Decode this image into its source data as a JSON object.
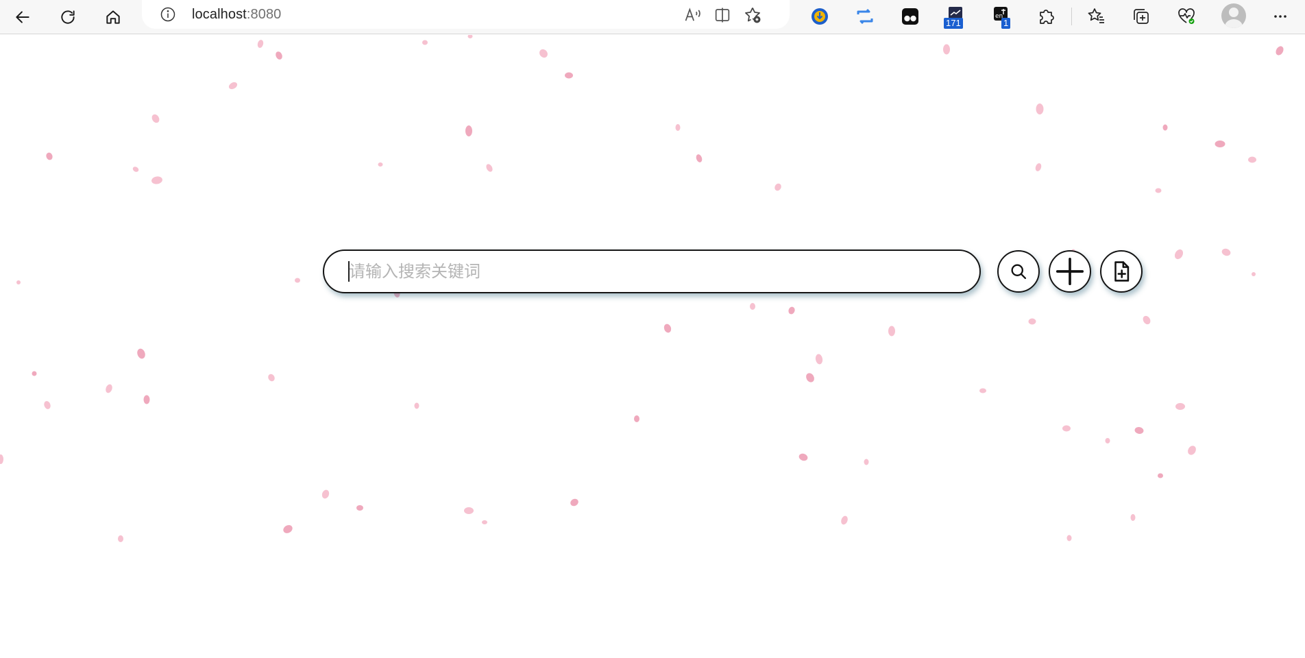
{
  "browser": {
    "address": {
      "host": "localhost",
      "port": ":8080"
    },
    "extensions": {
      "mail_badge": "171",
      "translate_badge": "1"
    },
    "icons": {
      "back": "back-arrow-icon",
      "refresh": "refresh-icon",
      "home": "home-icon",
      "info": "info-icon",
      "read_aloud": "read-aloud-icon",
      "split_screen": "split-screen-icon",
      "add_favorite": "add-favorite-icon",
      "favorites": "favorites-icon",
      "collections": "collections-icon",
      "performance": "performance-icon",
      "profile": "profile-avatar",
      "more": "more-menu-icon"
    }
  },
  "main": {
    "search": {
      "placeholder": "请输入搜索关键词",
      "value": ""
    },
    "buttons": [
      {
        "name": "search-button",
        "icon": "search-icon"
      },
      {
        "name": "add-button",
        "icon": "plus-icon"
      },
      {
        "name": "new-file-button",
        "icon": "file-plus-icon"
      }
    ],
    "background": {
      "petal_color": "#f4b6c8",
      "petal_color_dark": "#ec9ab1"
    }
  }
}
